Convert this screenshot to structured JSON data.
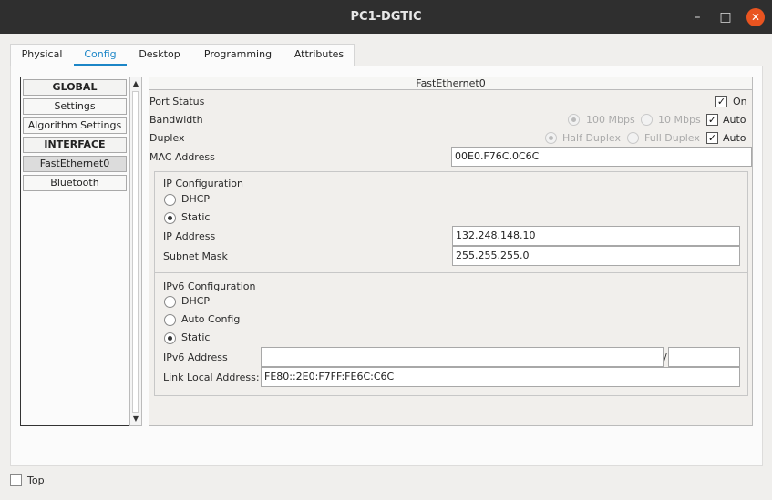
{
  "window": {
    "title": "PC1-DGTIC",
    "minimize_glyph": "–",
    "maximize_glyph": "□",
    "close_glyph": "✕"
  },
  "tabs": [
    {
      "label": "Physical"
    },
    {
      "label": "Config"
    },
    {
      "label": "Desktop"
    },
    {
      "label": "Programming"
    },
    {
      "label": "Attributes"
    }
  ],
  "active_tab": "Config",
  "sidebar": {
    "items": [
      {
        "label": "GLOBAL",
        "kind": "header"
      },
      {
        "label": "Settings",
        "kind": "item"
      },
      {
        "label": "Algorithm Settings",
        "kind": "item"
      },
      {
        "label": "INTERFACE",
        "kind": "header"
      },
      {
        "label": "FastEthernet0",
        "kind": "item",
        "selected": true
      },
      {
        "label": "Bluetooth",
        "kind": "item"
      }
    ],
    "scroll_up_glyph": "▲",
    "scroll_down_glyph": "▼"
  },
  "interface": {
    "title": "FastEthernet0",
    "port_status": {
      "label": "Port Status",
      "on_label": "On",
      "on_checked": true
    },
    "bandwidth": {
      "label": "Bandwidth",
      "opt1": "100 Mbps",
      "opt2": "10 Mbps",
      "auto_label": "Auto",
      "auto_checked": true
    },
    "duplex": {
      "label": "Duplex",
      "opt1": "Half Duplex",
      "opt2": "Full Duplex",
      "auto_label": "Auto",
      "auto_checked": true
    },
    "mac": {
      "label": "MAC Address",
      "value": "00E0.F76C.0C6C"
    }
  },
  "ip_config": {
    "title": "IP Configuration",
    "dhcp_label": "DHCP",
    "static_label": "Static",
    "mode": "Static",
    "ip_label": "IP Address",
    "ip_value": "132.248.148.10",
    "mask_label": "Subnet Mask",
    "mask_value": "255.255.255.0"
  },
  "ipv6_config": {
    "title": "IPv6 Configuration",
    "dhcp_label": "DHCP",
    "auto_label": "Auto Config",
    "static_label": "Static",
    "mode": "Static",
    "address_label": "IPv6 Address",
    "address_value": "",
    "prefix_value": "",
    "slash": "/",
    "link_local_label": "Link Local Address:",
    "link_local_value": "FE80::2E0:F7FF:FE6C:C6C"
  },
  "footer": {
    "top_label": "Top",
    "top_checked": false
  },
  "check_glyph": "✓"
}
